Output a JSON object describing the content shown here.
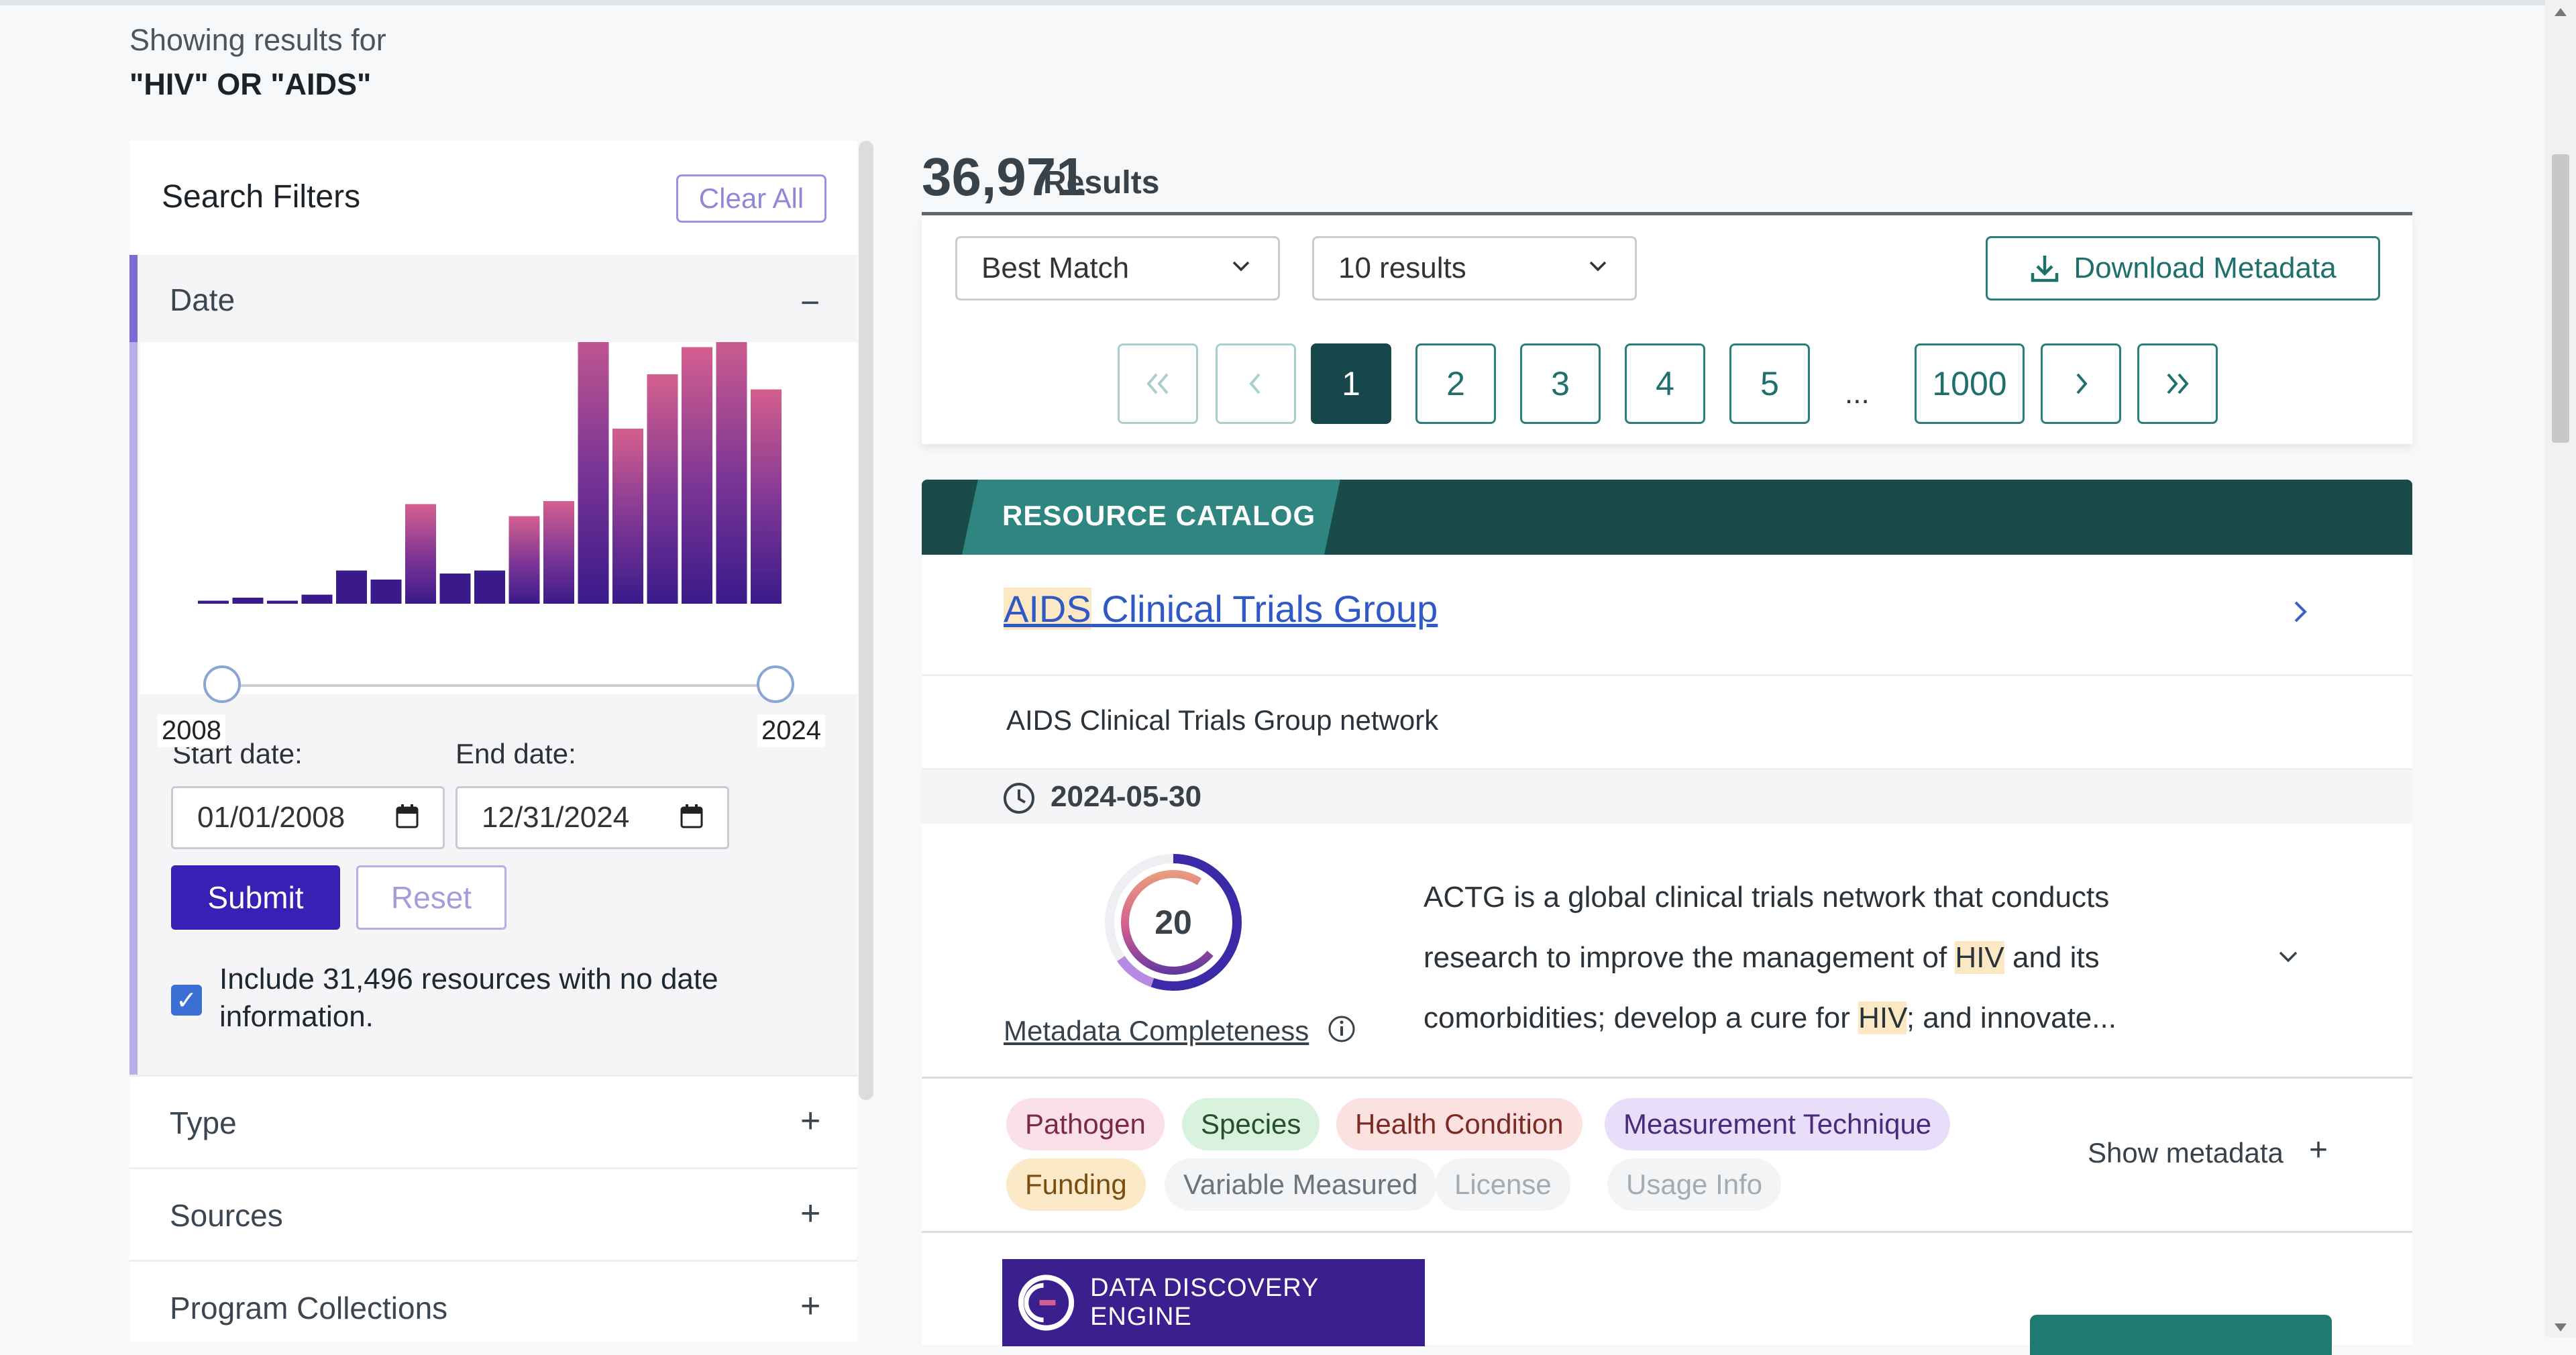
{
  "query": {
    "label": "Showing results for",
    "value": "\"HIV\" OR \"AIDS\""
  },
  "sidebar": {
    "title": "Search Filters",
    "clear_all": "Clear All",
    "date": {
      "header": "Date",
      "histogram_relative_heights": [
        0.01,
        0.02,
        0.01,
        0.03,
        0.11,
        0.08,
        0.33,
        0.1,
        0.11,
        0.29,
        0.34,
        1.0,
        0.58,
        0.76,
        0.85,
        0.92,
        0.71
      ],
      "range_start": "2008",
      "range_end": "2024",
      "start_label": "Start date:",
      "end_label": "End date:",
      "start_value": "01/01/2008",
      "end_value": "12/31/2024",
      "submit": "Submit",
      "reset": "Reset",
      "include_checked": true,
      "include_text": "Include 31,496 resources with no date information."
    },
    "facets": [
      {
        "label": "Type"
      },
      {
        "label": "Sources"
      },
      {
        "label": "Program Collections"
      }
    ]
  },
  "results": {
    "count": "36,971",
    "label": "Results",
    "sort": "Best Match",
    "per_page": "10 results",
    "download": "Download Metadata",
    "pagination": {
      "pages": [
        "1",
        "2",
        "3",
        "4",
        "5"
      ],
      "ellipsis": "...",
      "last": "1000",
      "current": "1"
    }
  },
  "card": {
    "catalog": "RESOURCE CATALOG",
    "title_highlight": "AIDS",
    "title_rest": " Clinical Trials Group",
    "subtitle": "AIDS Clinical Trials Group network",
    "date": "2024-05-30",
    "completeness_score": "20",
    "completeness_label": "Metadata Completeness",
    "description": {
      "p1": "ACTG is a global clinical trials network that conducts research to improve the management of ",
      "h1": "HIV",
      "p2": " and its comorbidities; develop a cure for ",
      "h2": "HIV",
      "p3": "; and innovate..."
    },
    "tags": [
      {
        "label": "Pathogen",
        "bg": "#fbe0e8",
        "fg": "#7a2a43"
      },
      {
        "label": "Species",
        "bg": "#d9f2dd",
        "fg": "#24502c"
      },
      {
        "label": "Health Condition",
        "bg": "#fbe1df",
        "fg": "#7e2a24"
      },
      {
        "label": "Measurement Technique",
        "bg": "#e9defa",
        "fg": "#4a2a7a"
      },
      {
        "label": "Funding",
        "bg": "#fbe9c7",
        "fg": "#7a4d12"
      },
      {
        "label": "Variable Measured",
        "bg": "#f3f4f5",
        "fg": "#6b747c"
      },
      {
        "label": "License",
        "bg": "#f3f4f5",
        "fg": "#a4abb1"
      },
      {
        "label": "Usage Info",
        "bg": "#f3f4f5",
        "fg": "#a4abb1"
      }
    ],
    "show_metadata": "Show metadata",
    "source_logo": "DATA DISCOVERY ENGINE"
  },
  "colors": {
    "brand_purple": "#3720b3",
    "teal": "#2b7f7b",
    "dark_teal": "#17474a",
    "link_blue": "#3059c8",
    "highlight": "#fce8c2"
  }
}
